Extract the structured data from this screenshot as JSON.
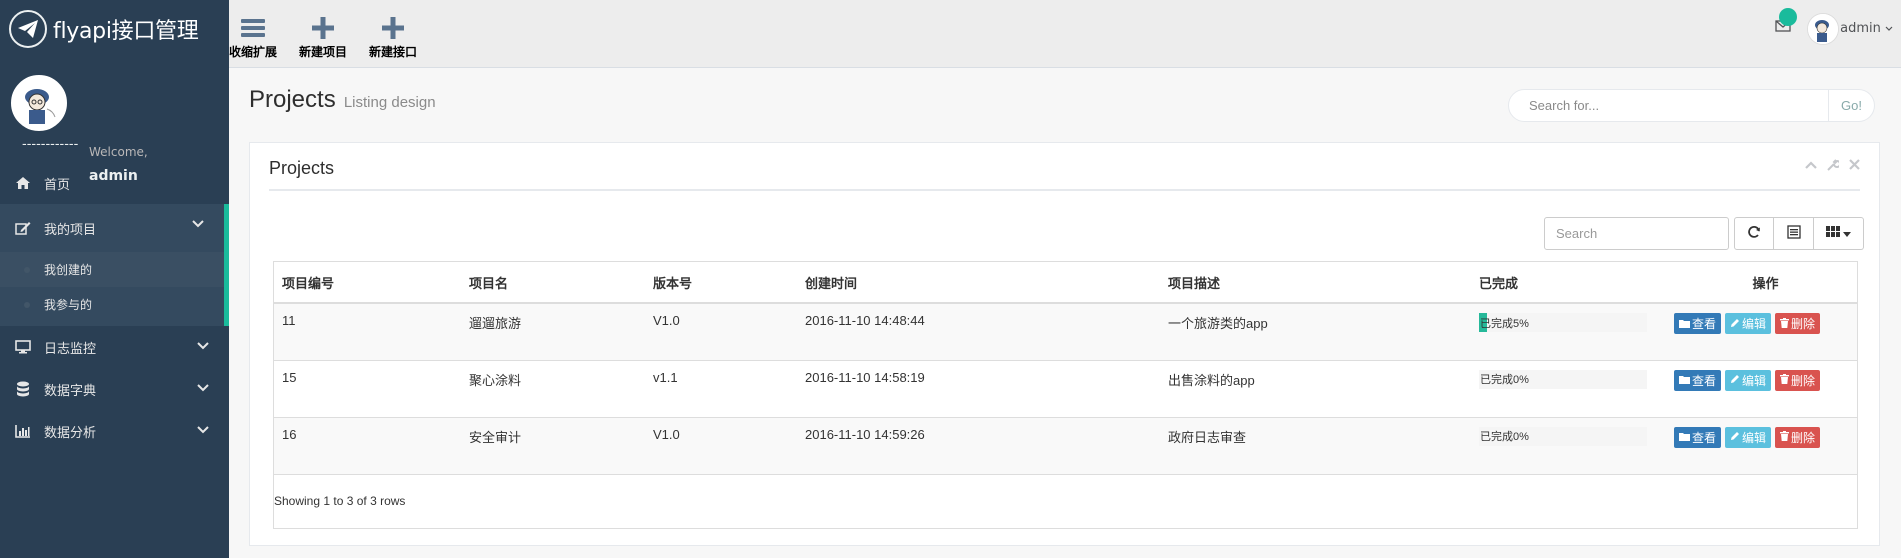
{
  "brand": {
    "title": "flyapi接口管理"
  },
  "profile": {
    "welcome": "Welcome,",
    "username": "admin",
    "divider": "------------"
  },
  "sidebar": {
    "items": [
      {
        "label": "首页",
        "icon": "home-icon"
      },
      {
        "label": "我的项目",
        "icon": "edit-icon",
        "expanded": true,
        "children": [
          {
            "label": "我创建的"
          },
          {
            "label": "我参与的"
          }
        ]
      },
      {
        "label": "日志监控",
        "icon": "desktop-icon"
      },
      {
        "label": "数据字典",
        "icon": "database-icon"
      },
      {
        "label": "数据分析",
        "icon": "bar-chart-icon"
      }
    ]
  },
  "toolbar": {
    "collapse_label": "收缩扩展",
    "new_project_label": "新建项目",
    "new_api_label": "新建接口"
  },
  "topright": {
    "mail_badge": "",
    "username": "admin"
  },
  "page": {
    "title": "Projects",
    "subtitle": "Listing design"
  },
  "search": {
    "placeholder": "Search for...",
    "go_label": "Go!"
  },
  "panel": {
    "title": "Projects"
  },
  "table": {
    "search_placeholder": "Search",
    "columns": [
      "项目编号",
      "项目名",
      "版本号",
      "创建时间",
      "项目描述",
      "已完成",
      "操作"
    ],
    "rows": [
      {
        "id": "11",
        "name": "遛遛旅游",
        "version": "V1.0",
        "created": "2016-11-10 14:48:44",
        "desc": "一个旅游类的app",
        "progress_text": "已完成5%",
        "progress": 5
      },
      {
        "id": "15",
        "name": "聚心涂料",
        "version": "v1.1",
        "created": "2016-11-10 14:58:19",
        "desc": "出售涂料的app",
        "progress_text": "已完成0%",
        "progress": 0
      },
      {
        "id": "16",
        "name": "安全审计",
        "version": "V1.0",
        "created": "2016-11-10 14:59:26",
        "desc": "政府日志审查",
        "progress_text": "已完成0%",
        "progress": 0
      }
    ],
    "actions": {
      "view": "查看",
      "edit": "编辑",
      "delete": "删除"
    },
    "footer": "Showing 1 to 3 of 3 rows"
  },
  "colors": {
    "sidebar_bg": "#2a3f54",
    "accent": "#1abb9c",
    "view_btn": "#337ab7",
    "edit_btn": "#5bc0de",
    "delete_btn": "#d9534f"
  }
}
